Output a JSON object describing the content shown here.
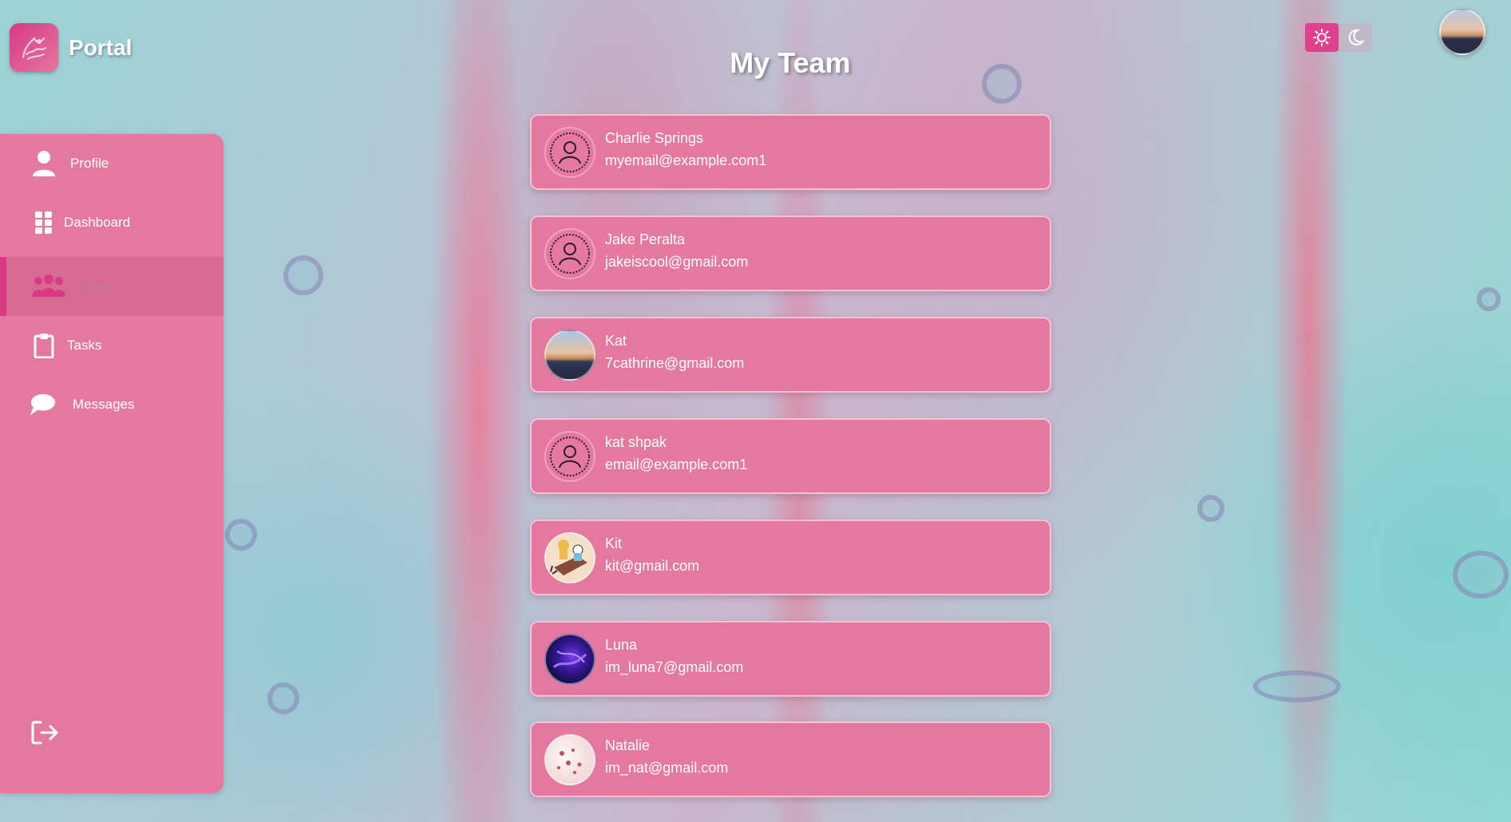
{
  "brand": {
    "name": "Portal"
  },
  "page": {
    "title": "My Team"
  },
  "theme": {
    "light_icon": "sun-icon",
    "dark_icon": "moon-icon",
    "active": "light"
  },
  "sidebar": {
    "items": [
      {
        "label": "Profile",
        "icon": "user-icon",
        "active": false
      },
      {
        "label": "Dashboard",
        "icon": "grid-icon",
        "active": false
      },
      {
        "label": "Team",
        "icon": "team-icon",
        "active": true
      },
      {
        "label": "Tasks",
        "icon": "clipboard-icon",
        "active": false
      },
      {
        "label": "Messages",
        "icon": "chat-bubble-icon",
        "active": false
      }
    ],
    "logout_icon": "logout-icon"
  },
  "team": {
    "members": [
      {
        "name": "Charlie Springs",
        "email": "myemail@example.com1",
        "avatar": "default"
      },
      {
        "name": "Jake Peralta",
        "email": "jakeiscool@gmail.com",
        "avatar": "default"
      },
      {
        "name": "Kat",
        "email": "7cathrine@gmail.com",
        "avatar": "sunset"
      },
      {
        "name": "kat shpak",
        "email": "email@example.com1",
        "avatar": "default"
      },
      {
        "name": "Kit",
        "email": "kit@gmail.com",
        "avatar": "cartoon"
      },
      {
        "name": "Luna",
        "email": "im_luna7@gmail.com",
        "avatar": "purple"
      },
      {
        "name": "Natalie",
        "email": "im_nat@gmail.com",
        "avatar": "flowers"
      }
    ]
  },
  "colors": {
    "accent": "#e0408d",
    "card": "#e5789f",
    "sidebar": "#e5789f"
  }
}
